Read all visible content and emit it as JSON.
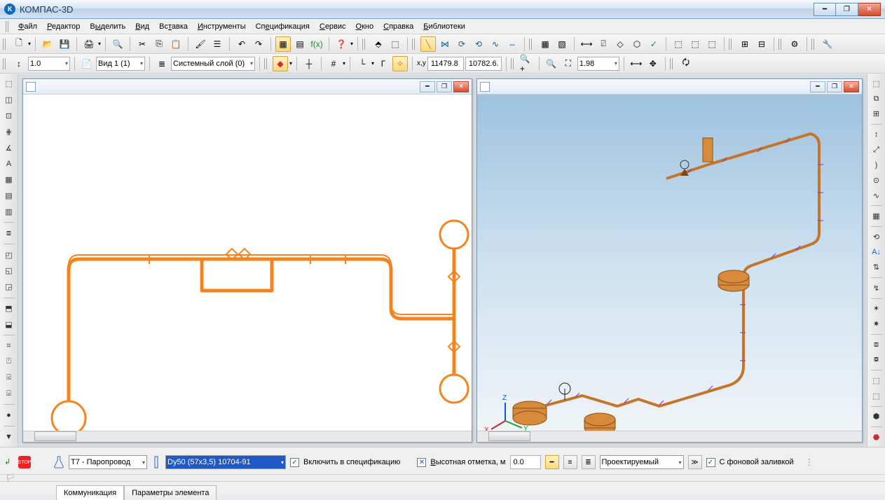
{
  "title": "КОМПАС-3D",
  "menu": [
    "Файл",
    "Редактор",
    "Выделить",
    "Вид",
    "Вставка",
    "Инструменты",
    "Спецификация",
    "Сервис",
    "Окно",
    "Справка",
    "Библиотеки"
  ],
  "menu_underline_idx": [
    0,
    0,
    1,
    0,
    2,
    0,
    2,
    0,
    0,
    0,
    0
  ],
  "toolbar2": {
    "scale_value": "1.0",
    "view_value": "Вид 1 (1)",
    "layer_value": "Системный слой (0)",
    "coord_prefix": "x,y",
    "coord_x": "11479.8",
    "coord_y": "10782.6..",
    "zoom_value": "1.98"
  },
  "bottom": {
    "type_value": "Т7 - Паропровод",
    "size_value": "Dy50 (57x3,5) 10704-91",
    "include_spec_label": "Включить в спецификацию",
    "height_label": "Высотная отметка, м",
    "height_value": "0.0",
    "state_value": "Проектируемый",
    "bg_fill_label": "С фоновой заливкой",
    "tab1": "Коммуникация",
    "tab2": "Параметры элемента"
  }
}
